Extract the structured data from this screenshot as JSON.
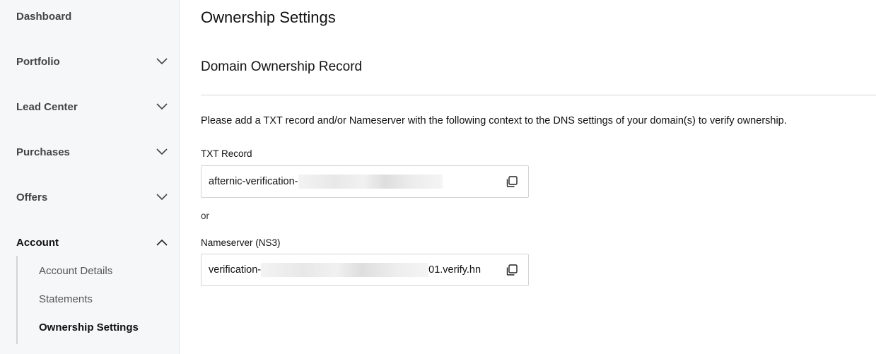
{
  "sidebar": {
    "items": [
      {
        "label": "Dashboard"
      },
      {
        "label": "Portfolio"
      },
      {
        "label": "Lead Center"
      },
      {
        "label": "Purchases"
      },
      {
        "label": "Offers"
      },
      {
        "label": "Account"
      }
    ],
    "sub_items": [
      {
        "label": "Account Details"
      },
      {
        "label": "Statements"
      },
      {
        "label": "Ownership Settings"
      }
    ]
  },
  "main": {
    "page_title": "Ownership Settings",
    "section_title": "Domain Ownership Record",
    "instructions": "Please add a TXT record and/or Nameserver with the following context to the DNS settings of your domain(s) to verify ownership.",
    "txt_record": {
      "label": "TXT Record",
      "value_prefix": "afternic-verification-"
    },
    "or_text": "or",
    "nameserver": {
      "label": "Nameserver (NS3)",
      "value_prefix": "verification-",
      "value_suffix": "01.verify.hn"
    }
  },
  "icons": {
    "chevron_down": "chevron-down-icon",
    "chevron_up": "chevron-up-icon",
    "copy": "copy-icon"
  },
  "colors": {
    "sidebar_bg": "#f5f7f8",
    "divider": "#d6d6d6",
    "text": "#111111"
  }
}
